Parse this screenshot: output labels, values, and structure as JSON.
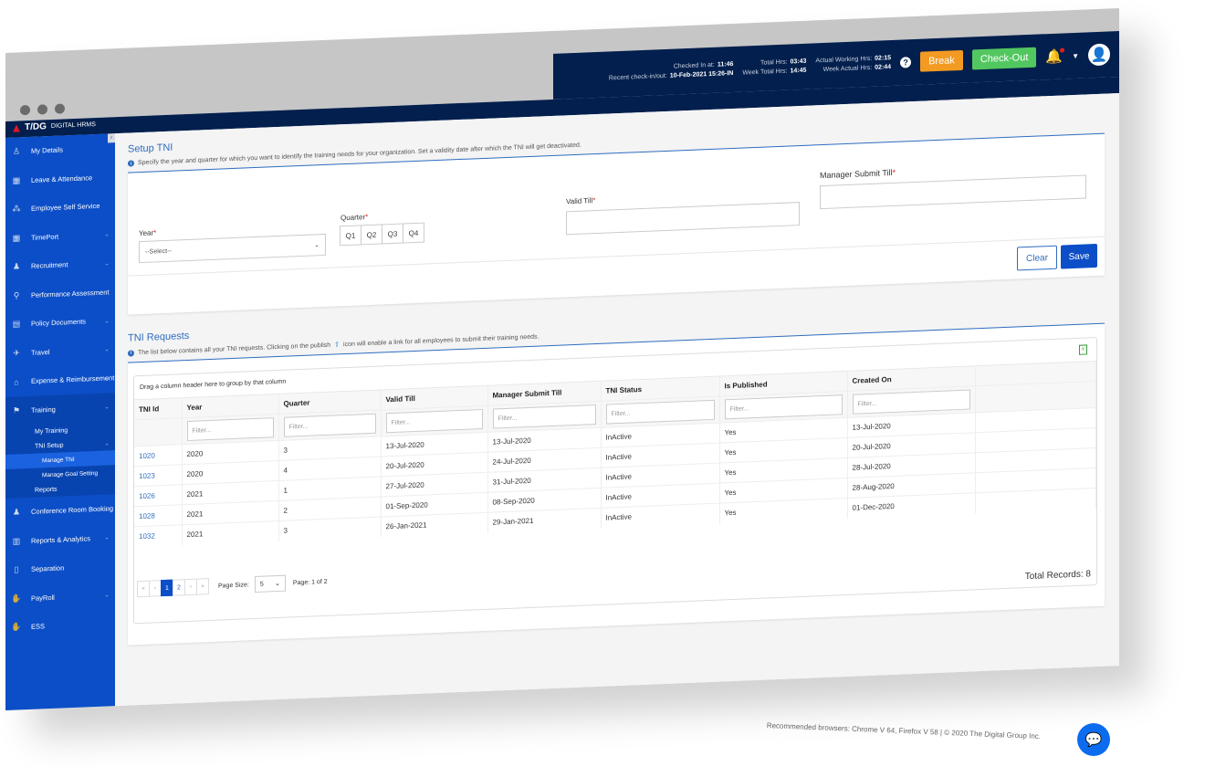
{
  "brand": {
    "logo_mark": "T/DG",
    "logo_text": "DIGITAL HRMS"
  },
  "header": {
    "checked_in_label": "Checked In at:",
    "checked_in_value": "11:46",
    "recent_label": "Recent check-in/out:",
    "recent_value": "10-Feb-2021 15:26-IN",
    "total_hrs_label": "Total Hrs:",
    "total_hrs_value": "03:43",
    "week_total_label": "Week Total Hrs:",
    "week_total_value": "14:45",
    "actual_working_label": "Actual Working Hrs:",
    "actual_working_value": "02:15",
    "week_actual_label": "Week Actual Hrs:",
    "week_actual_value": "02:44",
    "help_icon": "?",
    "break_label": "Break",
    "checkout_label": "Check-Out",
    "bell_icon": "🔔",
    "caret_icon": "▼",
    "avatar_icon": "👤"
  },
  "sidebar": {
    "collapse_icon": "‹",
    "items": [
      {
        "label": "My Details",
        "icon": "♙",
        "chevron": false
      },
      {
        "label": "Leave & Attendance",
        "icon": "▦",
        "chevron": false
      },
      {
        "label": "Employee Self Service",
        "icon": "⁂",
        "chevron": false
      },
      {
        "label": "TimePort",
        "icon": "▦",
        "chevron": true
      },
      {
        "label": "Recruitment",
        "icon": "♟",
        "chevron": true
      },
      {
        "label": "Performance Assessment",
        "icon": "⚲",
        "chevron": false
      },
      {
        "label": "Policy Documents",
        "icon": "▤",
        "chevron": true
      },
      {
        "label": "Travel",
        "icon": "✈",
        "chevron": true
      },
      {
        "label": "Expense & Reimbursement",
        "icon": "⌂",
        "chevron": true
      },
      {
        "label": "Training",
        "icon": "⚑",
        "chevron": true
      },
      {
        "label": "Conference Room Booking",
        "icon": "♟",
        "chevron": true
      },
      {
        "label": "Reports & Analytics",
        "icon": "▥",
        "chevron": true
      },
      {
        "label": "Separation",
        "icon": "▯",
        "chevron": false
      },
      {
        "label": "PayRoll",
        "icon": "✋",
        "chevron": true
      },
      {
        "label": "ESS",
        "icon": "✋",
        "chevron": false
      }
    ],
    "training_sub": {
      "my_training": "My Training",
      "tni_setup": "TNI Setup",
      "manage_tni": "Manage TNI",
      "manage_goal": "Manage Goal Setting",
      "reports": "Reports"
    },
    "chevron_icon": "⌄"
  },
  "setup": {
    "title": "Setup TNI",
    "info": "Specify the year and quarter for which you want to identify the training needs for your organization. Set a validity date after which the TNI will get deactivated.",
    "year_label": "Year",
    "year_value": "--Select--",
    "quarter_label": "Quarter",
    "quarters": [
      "Q1",
      "Q2",
      "Q3",
      "Q4"
    ],
    "valid_till_label": "Valid Till",
    "valid_till_value": "",
    "manager_submit_label": "Manager Submit Till",
    "manager_submit_value": "",
    "required_mark": "*",
    "clear_label": "Clear",
    "save_label": "Save"
  },
  "requests": {
    "title": "TNI Requests",
    "info_before": "The list below contains all your TNI requests. Clicking on the publish",
    "info_after": "icon will enable a link for all employees to submit their training needs.",
    "group_hint": "Drag a column header here to group by that column",
    "filter_placeholder": "Filter...",
    "columns": [
      "TNI Id",
      "Year",
      "Quarter",
      "Valid Till",
      "Manager Submit Till",
      "TNI Status",
      "Is Published",
      "Created On"
    ],
    "rows": [
      [
        "1020",
        "2020",
        "3",
        "13-Jul-2020",
        "13-Jul-2020",
        "InActive",
        "Yes",
        "13-Jul-2020"
      ],
      [
        "1023",
        "2020",
        "4",
        "20-Jul-2020",
        "24-Jul-2020",
        "InActive",
        "Yes",
        "20-Jul-2020"
      ],
      [
        "1026",
        "2021",
        "1",
        "27-Jul-2020",
        "31-Jul-2020",
        "InActive",
        "Yes",
        "28-Jul-2020"
      ],
      [
        "1028",
        "2021",
        "2",
        "01-Sep-2020",
        "08-Sep-2020",
        "InActive",
        "Yes",
        "28-Aug-2020"
      ],
      [
        "1032",
        "2021",
        "3",
        "26-Jan-2021",
        "29-Jan-2021",
        "InActive",
        "Yes",
        "01-Dec-2020"
      ]
    ],
    "pager": {
      "first": "«",
      "prev": "‹",
      "pages": [
        "1",
        "2"
      ],
      "active_page": "1",
      "next": "›",
      "last": "»",
      "page_size_label": "Page Size:",
      "page_size_value": "5",
      "page_info": "Page: 1 of 2"
    },
    "total_records": "Total Records: 8"
  },
  "footer": {
    "text": "Recommended browsers: Chrome V 64, Firefox V 58  |  © 2020 The Digital Group Inc.",
    "chat_icon": "💬"
  }
}
